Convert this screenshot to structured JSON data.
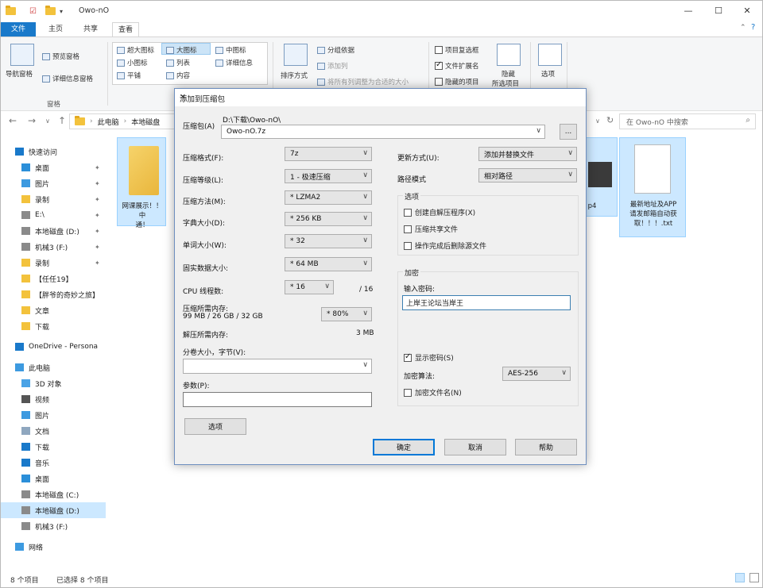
{
  "explorer": {
    "window_title": "Owo-nO",
    "ribbon_tabs": [
      "文件",
      "主页",
      "共享",
      "查看"
    ],
    "ribbon": {
      "pane_group": {
        "nav_pane": "导航窗格",
        "preview_pane": "预览窗格",
        "details_pane": "详细信息窗格",
        "label": "窗格"
      },
      "layout": {
        "items": [
          "超大图标",
          "大图标",
          "中图标",
          "小图标",
          "列表",
          "详细信息",
          "平铺",
          "内容"
        ]
      },
      "current_view": {
        "sort_by": "排序方式",
        "group_by": "分组依据",
        "add_column": "添加列",
        "size_columns": "将所有列调整为合适的大小"
      },
      "show_hide": {
        "item_checkboxes": "项目复选框",
        "file_extensions": "文件扩展名",
        "hidden_items": "隐藏的项目",
        "hide_selected_line1": "隐藏",
        "hide_selected_line2": "所选项目"
      },
      "options": "选项"
    },
    "address": {
      "pc": "此电脑",
      "drive": "本地磁盘"
    },
    "search_placeholder": "在 Owo-nO 中搜索",
    "sidebar": [
      {
        "label": "快速访问",
        "icon": "star-icon"
      },
      {
        "label": "桌面",
        "icon": "desktop-icon"
      },
      {
        "label": "图片",
        "icon": "pictures-icon"
      },
      {
        "label": "录制",
        "icon": "folder-icon"
      },
      {
        "label": "E:\\",
        "icon": "drive-icon"
      },
      {
        "label": "本地磁盘 (D:)",
        "icon": "drive-icon"
      },
      {
        "label": "机械3 (F:)",
        "icon": "drive-icon"
      },
      {
        "label": "录制",
        "icon": "folder-icon"
      },
      {
        "label": "【任任19】",
        "icon": "folder-icon"
      },
      {
        "label": "【胖爷的奇妙之旅】",
        "icon": "folder-icon"
      },
      {
        "label": "文章",
        "icon": "folder-icon"
      },
      {
        "label": "下载",
        "icon": "folder-icon"
      },
      {
        "label": "OneDrive - Persona",
        "icon": "cloud-icon"
      },
      {
        "label": "此电脑",
        "icon": "pc-icon"
      },
      {
        "label": "3D 对象",
        "icon": "cube-icon"
      },
      {
        "label": "视频",
        "icon": "video-icon"
      },
      {
        "label": "图片",
        "icon": "pictures-icon"
      },
      {
        "label": "文档",
        "icon": "documents-icon"
      },
      {
        "label": "下载",
        "icon": "download-icon"
      },
      {
        "label": "音乐",
        "icon": "music-icon"
      },
      {
        "label": "桌面",
        "icon": "desktop-icon"
      },
      {
        "label": "本地磁盘 (C:)",
        "icon": "drive-icon"
      },
      {
        "label": "本地磁盘 (D:)",
        "icon": "drive-icon"
      },
      {
        "label": "机械3 (F:)",
        "icon": "drive-icon"
      },
      {
        "label": "网络",
        "icon": "network-icon"
      }
    ],
    "files": [
      {
        "name_line1": "网课展示！！中",
        "name_line2": "通！"
      },
      {
        "name_line1": "p4",
        "name_line2": ""
      },
      {
        "name_line1": "最新地址及APP",
        "name_line2": "请发邮箱自动获",
        "name_line3": "取！！！.txt"
      }
    ],
    "status": {
      "count": "8 个项目",
      "selected": "已选择 8 个项目"
    }
  },
  "dialog": {
    "title": "添加到压缩包",
    "archive_label": "压缩包(A)",
    "archive_path": "D:\\下载\\Owo-nO\\",
    "archive_name": "Owo-nO.7z",
    "browse": "...",
    "format_label": "压缩格式(F):",
    "format_value": "7z",
    "level_label": "压缩等级(L):",
    "level_value": "1 - 极速压缩",
    "method_label": "压缩方法(M):",
    "method_value": "* LZMA2",
    "dict_label": "字典大小(D):",
    "dict_value": "* 256 KB",
    "word_label": "单词大小(W):",
    "word_value": "* 32",
    "solid_label": "固实数据大小:",
    "solid_value": "* 64 MB",
    "cpu_label": "CPU 线程数:",
    "cpu_value": "* 16",
    "cpu_total": "/ 16",
    "mem_label": "压缩所需内存:",
    "mem_detail": "99 MB / 26 GB / 32 GB",
    "mem_percent": "* 80%",
    "decomp_label": "解压所需内存:",
    "decomp_value": "3 MB",
    "split_label": "分卷大小，字节(V):",
    "split_value": "",
    "params_label": "参数(P):",
    "params_value": "",
    "options_button": "选项",
    "update_label": "更新方式(U):",
    "update_value": "添加并替换文件",
    "path_label": "路径模式",
    "path_value": "相对路径",
    "options_group": "选项",
    "opt_sfx": "创建自解压程序(X)",
    "opt_shared": "压缩共享文件",
    "opt_delete": "操作完成后删除源文件",
    "encrypt_group": "加密",
    "password_label": "输入密码:",
    "password_value": "上岸王论坛当岸王",
    "show_password": "显示密码(S)",
    "enc_method_label": "加密算法:",
    "enc_method_value": "AES-256",
    "enc_names": "加密文件名(N)",
    "ok": "确定",
    "cancel": "取消",
    "help": "帮助"
  }
}
